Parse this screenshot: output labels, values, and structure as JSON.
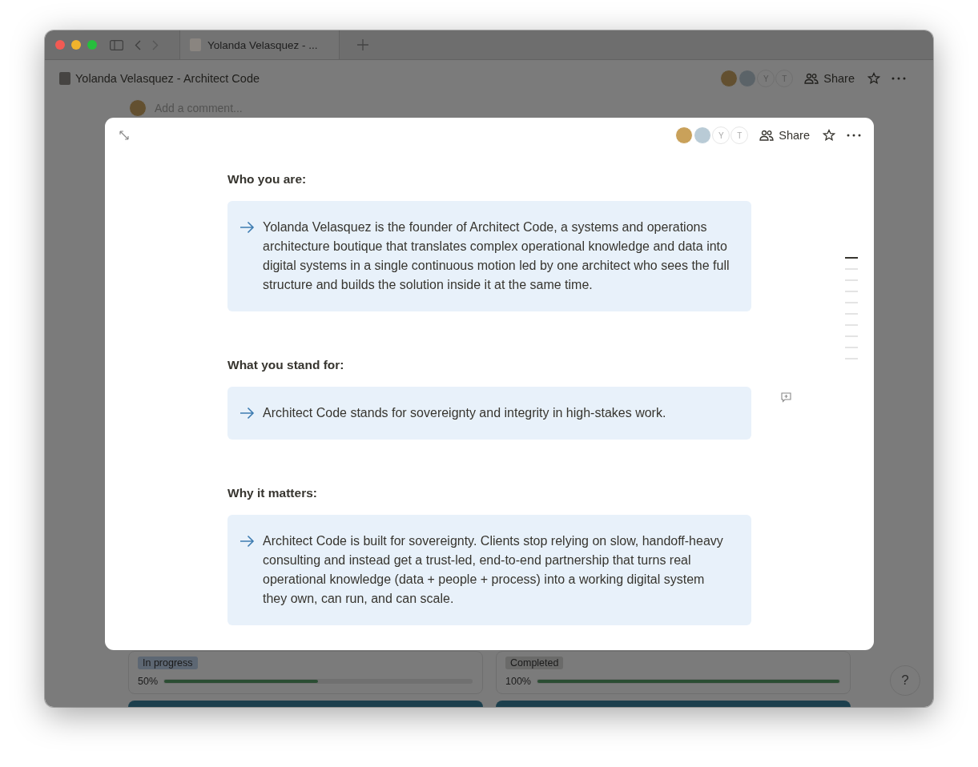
{
  "browser": {
    "tabs": [
      {
        "title": "Yolanda Velasquez - ...",
        "selected": true
      }
    ]
  },
  "page": {
    "title": "Yolanda Velasquez - Architect Code",
    "avatars": [
      {
        "kind": "photo"
      },
      {
        "kind": "photo"
      },
      {
        "kind": "letter",
        "initial": "Y"
      },
      {
        "kind": "letter",
        "initial": "T"
      }
    ],
    "share_label": "Share",
    "comment_placeholder": "Add a comment...",
    "cards": [
      {
        "status": "In progress",
        "color": "#5d6773",
        "progress_label": "50%",
        "level": 0.5
      },
      {
        "status": "Completed",
        "color": "#6a6a69",
        "progress_label": "100%",
        "level": 1
      }
    ],
    "help_label": "?"
  },
  "modal": {
    "avatars": [
      {
        "kind": "photo"
      },
      {
        "kind": "photo"
      },
      {
        "kind": "letter",
        "initial": "Y"
      },
      {
        "kind": "letter",
        "initial": "T"
      }
    ],
    "share_label": "Share",
    "sections": [
      {
        "heading": "Who you are:",
        "text": "Yolanda Velasquez is the founder of Architect Code, a systems and operations architecture boutique that translates complex operational knowledge and data into digital systems in a single continuous motion led by one architect who sees the full structure and builds the solution inside it at the same time."
      },
      {
        "heading": "What you stand for:",
        "text": "Architect Code stands for sovereignty and integrity in high-stakes work."
      },
      {
        "heading": "Why it matters:",
        "text": "Architect Code is built for sovereignty. Clients stop relying on slow, handoff-heavy consulting and instead get a trust-led, end-to-end partnership that turns real operational knowledge (data + people + process) into a working digital system they own, can run, and can scale."
      }
    ],
    "outline": [
      {
        "selected": true
      },
      {
        "selected": false
      },
      {
        "selected": false
      },
      {
        "selected": false
      },
      {
        "selected": false
      },
      {
        "selected": false
      },
      {
        "selected": false
      },
      {
        "selected": false
      },
      {
        "selected": false
      },
      {
        "selected": false
      }
    ]
  }
}
